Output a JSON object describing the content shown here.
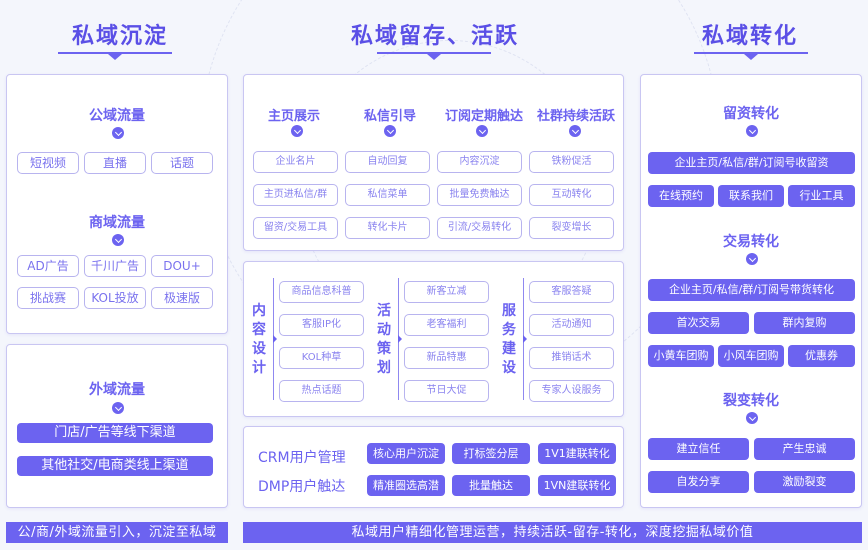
{
  "columns": {
    "left": {
      "title": "私域沉淀",
      "public": {
        "heading": "公域流量",
        "tags": [
          "短视频",
          "直播",
          "话题"
        ]
      },
      "commerce": {
        "heading": "商域流量",
        "tags": [
          "AD广告",
          "千川广告",
          "DOU+",
          "挑战赛",
          "KOL投放",
          "极速版"
        ]
      },
      "external": {
        "heading": "外域流量",
        "channels": [
          "门店/广告等线下渠道",
          "其他社交/电商类线上渠道"
        ]
      },
      "footer": "公/商/外域流量引入，沉淀至私域"
    },
    "middle": {
      "title": "私域留存、活跃",
      "touchpoints": {
        "headings": [
          "主页展示",
          "私信引导",
          "订阅定期触达",
          "社群持续活跃"
        ],
        "grid": [
          [
            "企业名片",
            "自动回复",
            "内容沉淀",
            "铁粉促活"
          ],
          [
            "主页进私信/群",
            "私信菜单",
            "批量免费触达",
            "互动转化"
          ],
          [
            "留资/交易工具",
            "转化卡片",
            "引流/交易转化",
            "裂变增长"
          ]
        ]
      },
      "operations": {
        "content": {
          "label": "内容设计",
          "items": [
            "商品信息科普",
            "客服IP化",
            "KOL种草",
            "热点话题"
          ]
        },
        "activity": {
          "label": "活动策划",
          "items": [
            "新客立减",
            "老客福利",
            "新品特惠",
            "节日大促"
          ]
        },
        "service": {
          "label": "服务建设",
          "items": [
            "客服答疑",
            "活动通知",
            "推销话术",
            "专家人设服务"
          ]
        }
      },
      "crm": {
        "rows": [
          {
            "label": "CRM用户管理",
            "items": [
              "核心用户沉淀",
              "打标签分层",
              "1V1建联转化"
            ]
          },
          {
            "label": "DMP用户触达",
            "items": [
              "精准圈选高潜",
              "批量触达",
              "1VN建联转化"
            ]
          }
        ]
      }
    },
    "right": {
      "title": "私域转化",
      "leads": {
        "heading": "留资转化",
        "main": "企业主页/私信/群/订阅号收留资",
        "items": [
          "在线预约",
          "联系我们",
          "行业工具"
        ]
      },
      "trade": {
        "heading": "交易转化",
        "main": "企业主页/私信/群/订阅号带货转化",
        "row1": [
          "首次交易",
          "群内复购"
        ],
        "row2": [
          "小黄车团购",
          "小风车团购",
          "优惠券"
        ]
      },
      "fission": {
        "heading": "裂变转化",
        "row1": [
          "建立信任",
          "产生忠诚"
        ],
        "row2": [
          "自发分享",
          "激励裂变"
        ]
      }
    }
  },
  "bottom_banner": "私域用户精细化管理运营，持续活跃-留存-转化，深度挖掘私域价值",
  "colors": {
    "accent": "#6c63f0",
    "title": "#5a4fe6",
    "border": "#c9c6f2",
    "background": "#f4f6fc"
  }
}
